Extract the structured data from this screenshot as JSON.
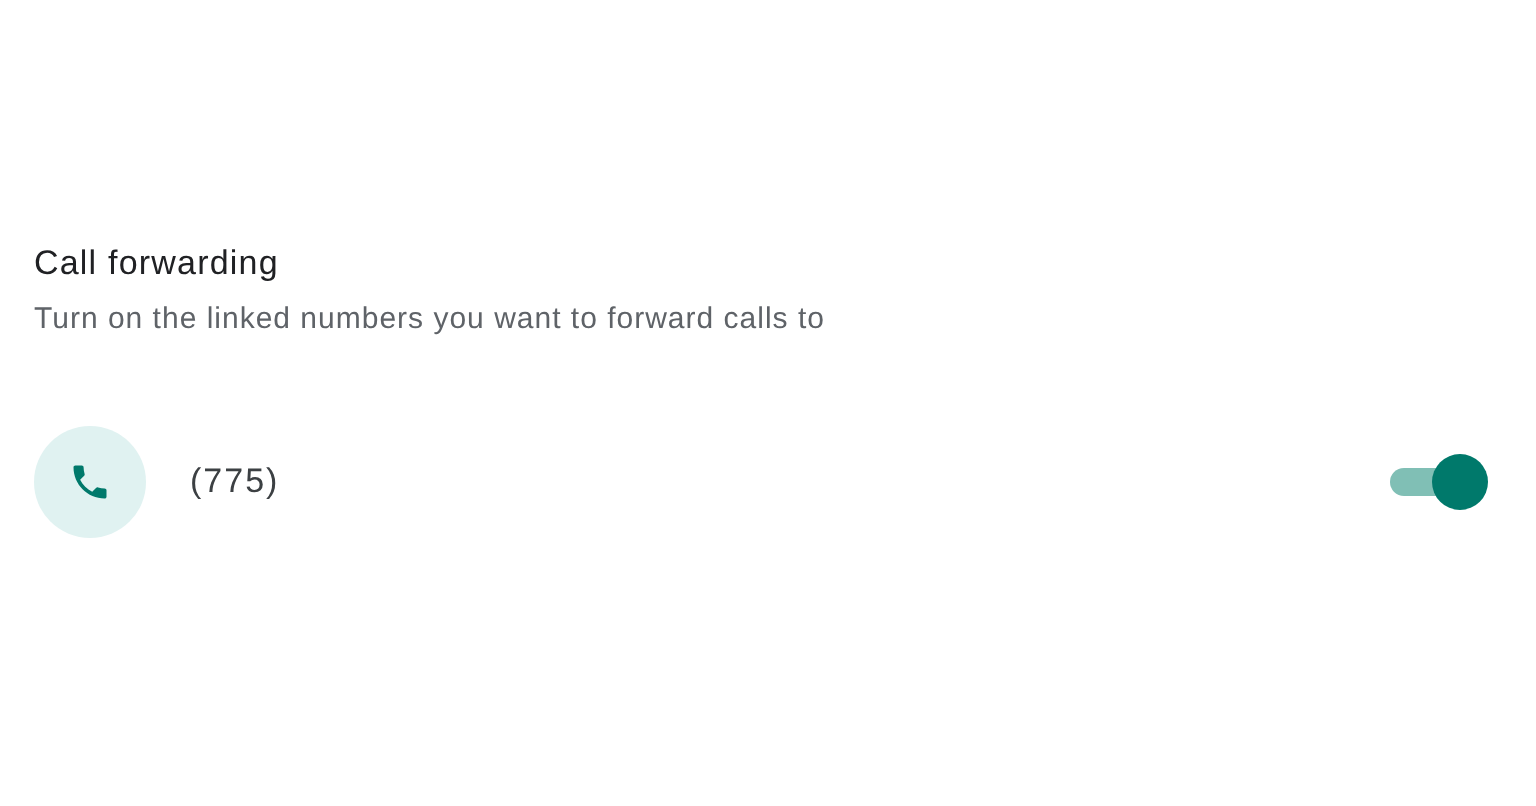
{
  "section": {
    "title": "Call forwarding",
    "description": "Turn on the linked numbers you want to forward calls to"
  },
  "numbers": [
    {
      "number": "(775)",
      "on": true
    }
  ]
}
